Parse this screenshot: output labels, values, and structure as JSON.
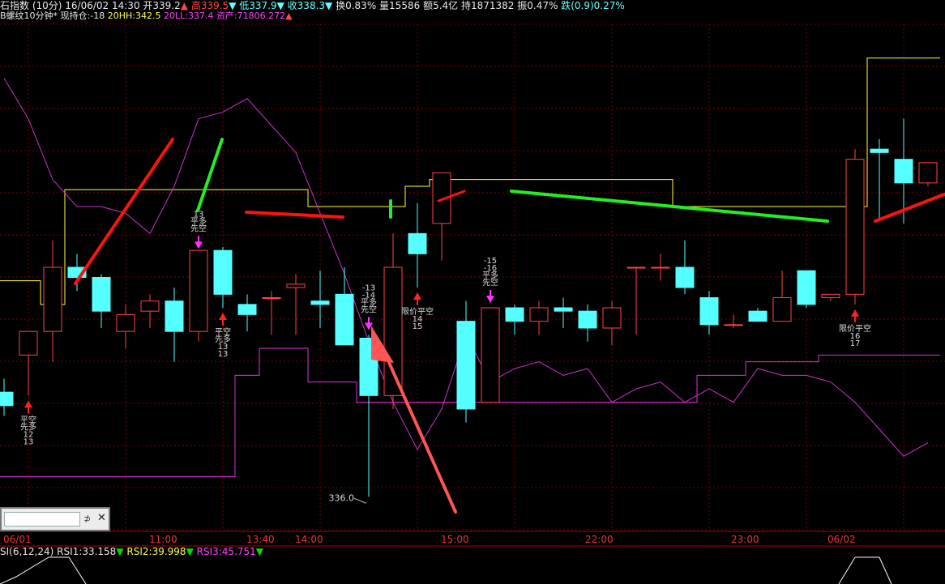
{
  "header": {
    "name": "石指数 (10分)",
    "datetime": "16/06/02 14:30",
    "open": "开339.2",
    "high": "高339.5",
    "low": "低337.9",
    "close": "收338.3",
    "turnover": "换0.83%",
    "volume": "量15586",
    "amount": "额5.4亿",
    "holding": "持1871382",
    "amplitude": "振0.47%",
    "change": "跌(0.9)0.27%"
  },
  "indicator": {
    "name": "B螺纹10分钟*",
    "position": "现持仓:-18",
    "hh": "20HH:342.5",
    "ll": "20LL:337.4",
    "assets": "资产:71806.272"
  },
  "float_panel": {
    "pin": "⊅",
    "close": "✕"
  },
  "time_axis": [
    {
      "label": "06/01"
    },
    {
      "label": "11:00"
    },
    {
      "label": "13:40"
    },
    {
      "label": "14:00"
    },
    {
      "label": "15:00"
    },
    {
      "label": "22:00"
    },
    {
      "label": "23:00"
    },
    {
      "label": "06/02"
    }
  ],
  "rsi": {
    "name": "SI(6,12,24)",
    "rsi1": "RSI1:33.158",
    "rsi2": "RSI2:39.998",
    "rsi3": "RSI3:45.751"
  },
  "colors": {
    "up": "#ff4444",
    "down": "#55ffff",
    "hh_line": "#ffff44",
    "ll_line": "#dd33dd",
    "grid": "#7a0000",
    "trend_red": "#ff1111",
    "trend_green": "#22ee22",
    "arrow": "#ff5555"
  },
  "chart_data": {
    "type": "candlestick",
    "title": "",
    "ylim": [
      335.5,
      343.0
    ],
    "low_annotation": "336.0",
    "candles": [
      {
        "o": 337.55,
        "h": 337.75,
        "l": 337.2,
        "c": 337.35
      },
      {
        "o": 338.1,
        "h": 338.2,
        "l": 337.5,
        "c": 338.45
      },
      {
        "o": 338.45,
        "h": 339.8,
        "l": 338.0,
        "c": 339.4
      },
      {
        "o": 339.4,
        "h": 339.6,
        "l": 339.05,
        "c": 339.25
      },
      {
        "o": 339.25,
        "h": 339.3,
        "l": 338.5,
        "c": 338.75
      },
      {
        "o": 338.45,
        "h": 338.85,
        "l": 338.2,
        "c": 338.7
      },
      {
        "o": 338.75,
        "h": 339.0,
        "l": 338.5,
        "c": 338.9
      },
      {
        "o": 338.9,
        "h": 339.1,
        "l": 338.0,
        "c": 338.45
      },
      {
        "o": 338.45,
        "h": 339.6,
        "l": 338.3,
        "c": 339.65
      },
      {
        "o": 339.65,
        "h": 339.7,
        "l": 338.8,
        "c": 339.0
      },
      {
        "o": 338.85,
        "h": 339.0,
        "l": 338.45,
        "c": 338.7
      },
      {
        "o": 338.95,
        "h": 339.05,
        "l": 338.4,
        "c": 338.95
      },
      {
        "o": 339.1,
        "h": 339.3,
        "l": 338.4,
        "c": 339.15
      },
      {
        "o": 338.9,
        "h": 339.35,
        "l": 338.5,
        "c": 338.85
      },
      {
        "o": 339.0,
        "h": 339.4,
        "l": 338.3,
        "c": 338.25
      },
      {
        "o": 338.35,
        "h": 338.4,
        "l": 336.0,
        "c": 337.5
      },
      {
        "o": 337.5,
        "h": 339.9,
        "l": 337.3,
        "c": 339.4
      },
      {
        "o": 339.9,
        "h": 340.35,
        "l": 339.1,
        "c": 339.6
      },
      {
        "o": 340.05,
        "h": 340.5,
        "l": 339.5,
        "c": 340.8
      },
      {
        "o": 338.6,
        "h": 338.9,
        "l": 337.1,
        "c": 337.3
      },
      {
        "o": 337.4,
        "h": 338.8,
        "l": 337.4,
        "c": 338.8
      },
      {
        "o": 338.8,
        "h": 338.85,
        "l": 338.4,
        "c": 338.6
      },
      {
        "o": 338.6,
        "h": 338.9,
        "l": 338.4,
        "c": 338.8
      },
      {
        "o": 338.8,
        "h": 338.95,
        "l": 338.5,
        "c": 338.75
      },
      {
        "o": 338.75,
        "h": 338.85,
        "l": 338.3,
        "c": 338.5
      },
      {
        "o": 338.5,
        "h": 338.9,
        "l": 338.25,
        "c": 338.8
      },
      {
        "o": 339.4,
        "h": 339.4,
        "l": 338.4,
        "c": 339.4
      },
      {
        "o": 339.4,
        "h": 339.6,
        "l": 339.2,
        "c": 339.4
      },
      {
        "o": 339.4,
        "h": 339.8,
        "l": 339.0,
        "c": 339.1
      },
      {
        "o": 338.95,
        "h": 339.05,
        "l": 338.4,
        "c": 338.55
      },
      {
        "o": 338.55,
        "h": 338.7,
        "l": 338.5,
        "c": 338.55
      },
      {
        "o": 338.75,
        "h": 338.8,
        "l": 338.6,
        "c": 338.6
      },
      {
        "o": 338.6,
        "h": 339.35,
        "l": 338.6,
        "c": 338.95
      },
      {
        "o": 339.35,
        "h": 339.35,
        "l": 338.8,
        "c": 338.85
      },
      {
        "o": 338.95,
        "h": 339.0,
        "l": 338.9,
        "c": 339.0
      },
      {
        "o": 339.0,
        "h": 341.15,
        "l": 338.85,
        "c": 341.0
      },
      {
        "o": 341.15,
        "h": 341.3,
        "l": 340.1,
        "c": 341.1
      },
      {
        "o": 341.0,
        "h": 341.6,
        "l": 340.05,
        "c": 340.65
      },
      {
        "o": 340.65,
        "h": 340.95,
        "l": 340.6,
        "c": 340.95
      }
    ],
    "hh_series": [
      339.2,
      339.2,
      338.85,
      340.55,
      340.55,
      340.55,
      340.55,
      340.55,
      340.55,
      340.55,
      340.55,
      340.55,
      340.55,
      340.3,
      340.3,
      340.3,
      340.3,
      340.6,
      340.7,
      340.7,
      340.7,
      340.7,
      340.7,
      340.7,
      340.7,
      340.7,
      340.7,
      340.7,
      340.3,
      340.3,
      340.3,
      340.3,
      340.3,
      340.3,
      340.3,
      340.3,
      342.5,
      342.5,
      342.5
    ],
    "ll_series": [
      336.3,
      336.3,
      336.3,
      336.3,
      336.3,
      336.3,
      336.3,
      336.3,
      336.3,
      336.3,
      337.8,
      338.2,
      338.2,
      337.7,
      337.7,
      337.4,
      337.4,
      337.4,
      337.4,
      337.4,
      337.4,
      337.4,
      337.4,
      337.4,
      337.4,
      337.4,
      337.4,
      337.4,
      337.4,
      337.8,
      337.8,
      338.0,
      338.0,
      338.0,
      338.1,
      338.1,
      338.1,
      338.1,
      338.1
    ],
    "wealth_series": [
      342.2,
      341.6,
      340.7,
      340.3,
      340.3,
      340.2,
      339.9,
      340.6,
      341.6,
      341.7,
      341.9,
      341.5,
      341.1,
      340.2,
      339.3,
      338.3,
      337.4,
      336.7,
      337.3,
      338.4,
      337.7,
      337.9,
      338.0,
      337.8,
      337.9,
      337.4,
      337.6,
      337.7,
      337.4,
      337.6,
      337.4,
      337.9,
      337.8,
      337.8,
      337.7,
      337.4,
      337.0,
      336.6,
      336.8
    ],
    "signals": [
      {
        "i": 1,
        "dir": "up",
        "lines": [
          "平空",
          "先多",
          "12",
          "13"
        ]
      },
      {
        "i": 8,
        "dir": "down",
        "lines": [
          "13",
          "平多",
          "先空"
        ]
      },
      {
        "i": 9,
        "dir": "up",
        "lines": [
          "平空",
          "先多",
          "13",
          "13"
        ]
      },
      {
        "i": 15,
        "dir": "down",
        "lines": [
          "-13",
          "-14",
          "平多",
          "先空"
        ]
      },
      {
        "i": 17,
        "dir": "up",
        "lines": [
          "限价平空",
          "14",
          "15"
        ]
      },
      {
        "i": 20,
        "dir": "down",
        "lines": [
          "-15",
          "-16",
          "平多",
          "先空"
        ]
      },
      {
        "i": 35,
        "dir": "up",
        "lines": [
          "限价平空",
          "16",
          "17"
        ]
      }
    ]
  }
}
